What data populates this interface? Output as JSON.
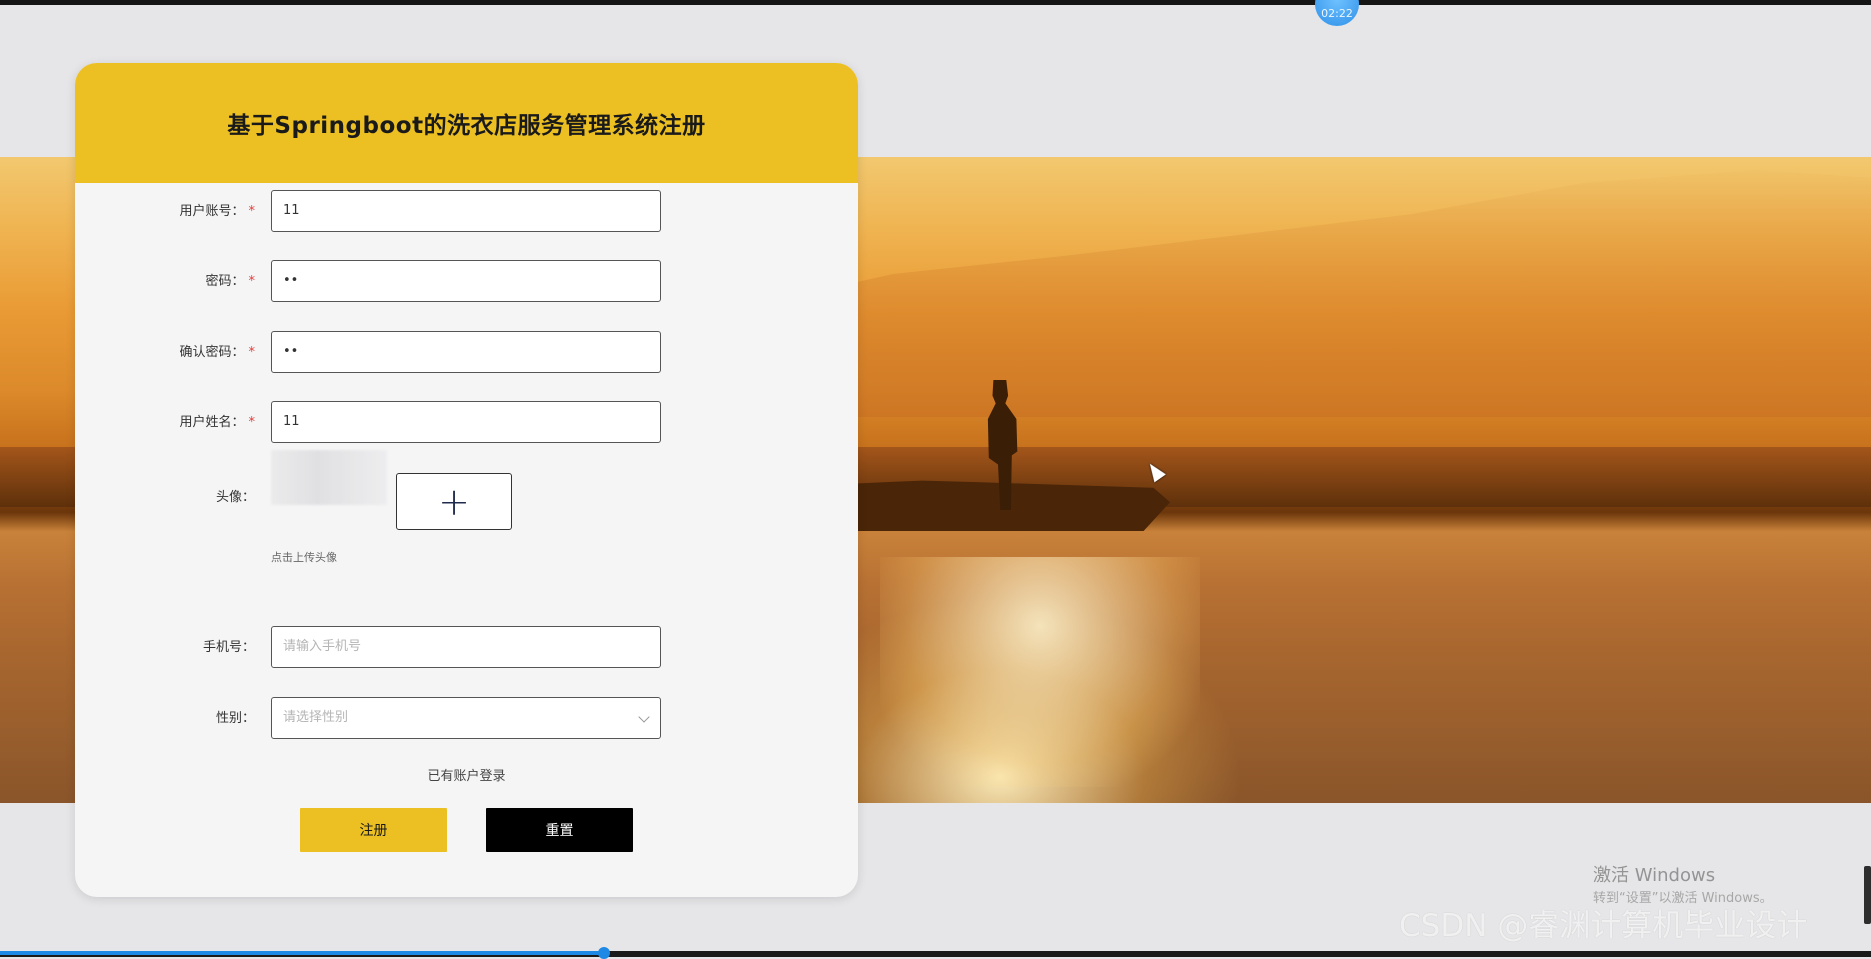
{
  "timer": "02:22",
  "form": {
    "title": "基于Springboot的洗衣店服务管理系统注册",
    "account": {
      "label": "用户账号：",
      "value": "11"
    },
    "password": {
      "label": "密码：",
      "value": "••"
    },
    "confirm_password": {
      "label": "确认密码：",
      "value": "••"
    },
    "name": {
      "label": "用户姓名：",
      "value": "11"
    },
    "avatar": {
      "label": "头像：",
      "upload_glyph": "+",
      "hint": "点击上传头像"
    },
    "phone": {
      "label": "手机号：",
      "placeholder": "请输入手机号"
    },
    "gender": {
      "label": "性别：",
      "placeholder": "请选择性别"
    },
    "required_mark": "*",
    "login_link": "已有账户登录",
    "register_button": "注册",
    "reset_button": "重置"
  },
  "watermarks": {
    "windows_line1": "激活 Windows",
    "windows_line2": "转到“设置”以激活 Windows。",
    "csdn": "CSDN @睿渊计算机毕业设计"
  },
  "video_progress": 0.323,
  "colors": {
    "accent": "#ecc022",
    "button_dark": "#000000",
    "progress": "#1e88e5"
  }
}
